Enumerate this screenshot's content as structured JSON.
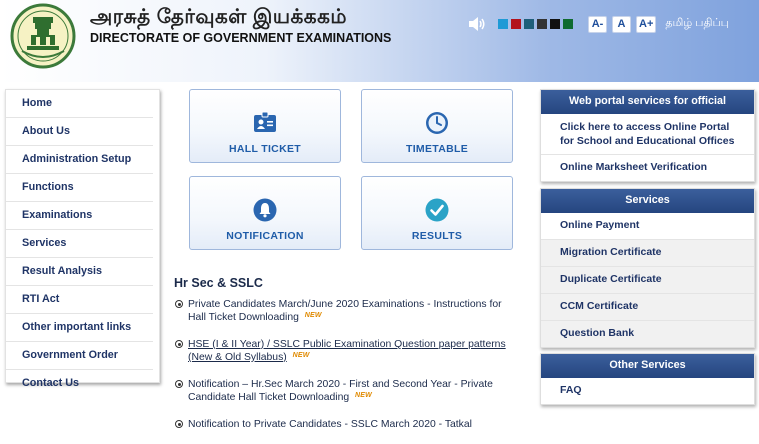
{
  "header": {
    "title_tamil": "அரசுத் தேர்வுகள் இயக்ககம்",
    "title_english": "DIRECTORATE OF GOVERNMENT EXAMINATIONS",
    "theme_colors": [
      "#1e9ad6",
      "#b3121c",
      "#1f5f7a",
      "#333333",
      "#111111",
      "#0f6b2f"
    ],
    "font_small": "A-",
    "font_normal": "A",
    "font_large": "A+",
    "tamil_version": "தமிழ் பதிப்பு"
  },
  "leftnav": {
    "items": [
      "Home",
      "About Us",
      "Administration Setup",
      "Functions",
      "Examinations",
      "Services",
      "Result Analysis",
      "RTI Act",
      "Other important links",
      "Government Order",
      "Contact Us"
    ]
  },
  "tiles": {
    "hall_ticket": "HALL TICKET",
    "timetable": "TIMETABLE",
    "notification": "NOTIFICATION",
    "results": "RESULTS"
  },
  "news": {
    "title": "Hr Sec & SSLC",
    "items": [
      "Private Candidates March/June 2020 Examinations - Instructions for Hall Ticket Downloading",
      "HSE (I & II Year) / SSLC Public Examination Question paper patterns (New & Old Syllabus)",
      "Notification – Hr.Sec March 2020 - First and Second Year - Private Candidate Hall Ticket Downloading",
      "Notification to Private Candidates - SSLC March 2020 - Tatkal"
    ],
    "new_badge": "NEW"
  },
  "right": {
    "portal_title": "Web portal services for official",
    "portal_items": [
      "Click here to access Online Portal for School and Educational Offices",
      "Online Marksheet Verification"
    ],
    "services_title": "Services",
    "services_items": [
      "Online Payment",
      "Migration Certificate",
      "Duplicate Certificate",
      "CCM Certificate",
      "Question Bank"
    ],
    "other_title": "Other Services",
    "other_items": [
      "FAQ"
    ]
  },
  "colors": {
    "nav_header": "#25457f",
    "tile_label": "#1f5ca8",
    "icon_blue": "#2a66b0",
    "results_teal": "#2aa3c7"
  }
}
